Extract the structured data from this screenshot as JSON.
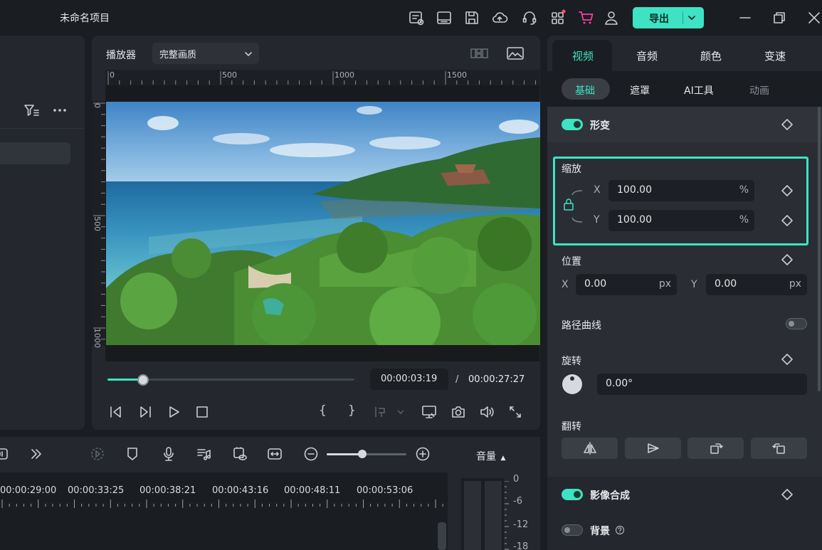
{
  "app": {
    "project_title": "未命名项目",
    "export_label": "导出"
  },
  "player": {
    "label": "播放器",
    "quality": "完整画质",
    "ruler_h": [
      "0",
      "500",
      "1000",
      "1500"
    ],
    "ruler_v": [
      "0",
      "500",
      "1000"
    ],
    "current_time": "00:00:03:19",
    "separator": "/",
    "total_time": "00:00:27:27",
    "progress": 0.145,
    "bracket_in": "{",
    "bracket_out": "}"
  },
  "properties": {
    "tabs": [
      "视频",
      "音频",
      "颜色",
      "变速"
    ],
    "active_tab": "视频",
    "subtabs": [
      "基础",
      "遮罩",
      "AI工具",
      "动画"
    ],
    "active_subtab": "基础",
    "transform": {
      "title": "形变",
      "enabled": true
    },
    "scale": {
      "label": "缩放",
      "x_axis": "X",
      "x_value": "100.00",
      "x_unit": "%",
      "y_axis": "Y",
      "y_value": "100.00",
      "y_unit": "%"
    },
    "position": {
      "label": "位置",
      "x_axis": "X",
      "x_value": "0.00",
      "x_unit": "px",
      "y_axis": "Y",
      "y_value": "0.00",
      "y_unit": "px"
    },
    "path_curve": {
      "label": "路径曲线",
      "enabled": false
    },
    "rotation": {
      "label": "旋转",
      "value": "0.00°"
    },
    "flip": {
      "label": "翻转"
    },
    "compositing": {
      "title": "影像合成",
      "enabled": true
    },
    "background": {
      "title": "背景",
      "enabled": false
    }
  },
  "timeline": {
    "timecodes": [
      "00:00:29:00",
      "00:00:33:25",
      "00:00:38:21",
      "00:00:43:16",
      "00:00:48:11",
      "00:00:53:06"
    ],
    "zoom": 0.45
  },
  "audio_meter": {
    "label": "音量",
    "db_labels": [
      "0",
      "-6",
      "-12",
      "-18"
    ]
  },
  "colors": {
    "accent": "#3de3c3",
    "background": "#1a1d21",
    "panel": "#24282e"
  }
}
